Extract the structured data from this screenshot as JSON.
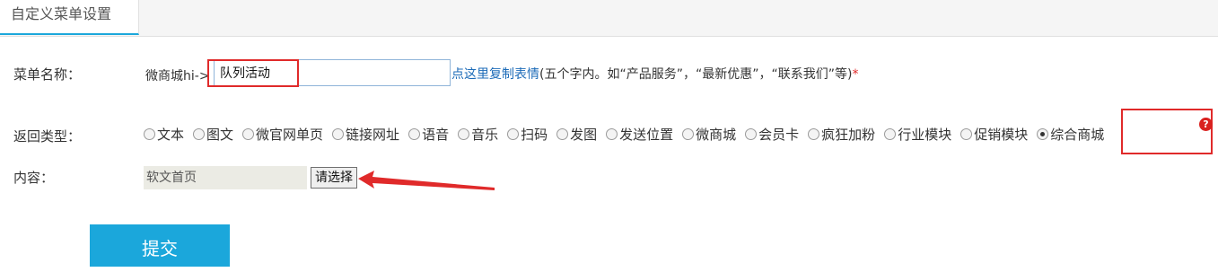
{
  "tab": {
    "label": "自定义菜单设置"
  },
  "form": {
    "menu_name_label": "菜单名称：",
    "prefix": "微商城hi->",
    "menu_name_value": "队列活动",
    "hint_link": "点这里复制表情",
    "hint_text": "(五个字内。如“产品服务”，“最新优惠”，“联系我们”等)",
    "required_mark": "*",
    "return_type_label": "返回类型：",
    "return_types": [
      {
        "label": "文本",
        "checked": false
      },
      {
        "label": "图文",
        "checked": false
      },
      {
        "label": "微官网单页",
        "checked": false
      },
      {
        "label": "链接网址",
        "checked": false
      },
      {
        "label": "语音",
        "checked": false
      },
      {
        "label": "音乐",
        "checked": false
      },
      {
        "label": "扫码",
        "checked": false
      },
      {
        "label": "发图",
        "checked": false
      },
      {
        "label": "发送位置",
        "checked": false
      },
      {
        "label": "微商城",
        "checked": false
      },
      {
        "label": "会员卡",
        "checked": false
      },
      {
        "label": "疯狂加粉",
        "checked": false
      },
      {
        "label": "行业模块",
        "checked": false
      },
      {
        "label": "促销模块",
        "checked": false
      },
      {
        "label": "综合商城",
        "checked": true
      }
    ],
    "help_icon": "?",
    "content_label": "内容：",
    "content_value": "软文首页",
    "choose_button": "请选择",
    "submit_button": "提交"
  },
  "colors": {
    "accent": "#1ba7db",
    "highlight": "#e02a2a",
    "link": "#1c6bb8"
  }
}
